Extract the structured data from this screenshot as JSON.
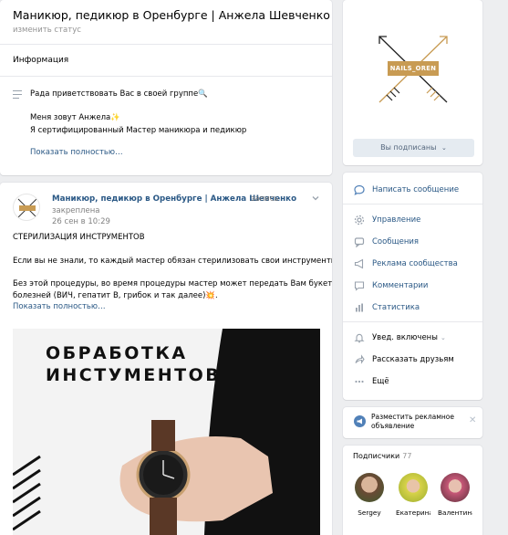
{
  "group": {
    "title": "Маникюр, педикюр в Оренбурге | Анжела Шевченко",
    "change_status": "изменить статус",
    "info_label": "Информация",
    "description_lines": [
      "Рада приветствовать Вас в своей группе🔍",
      "Меня зовут Анжела✨",
      "Я сертифицированный Мастер маникюра и педикюр"
    ],
    "show_more": "Показать полностью…"
  },
  "post": {
    "author": "Маникюр, педикюр в Оренбурге | Анжела Шевченко",
    "pinned_word": "запись",
    "pinned_word2": "закреплена",
    "date": "26 сен в 10:29",
    "lines": [
      "СТЕРИЛИЗАЦИЯ ИНСТРУМЕНТОВ",
      "Если вы не знали, то каждый мастер обязан стерилизовать свои инструменты🔝.",
      "Без этой процедуры, во время процедуры мастер может передать Вам букет",
      "болезней (ВИЧ, гепатит В, грибок и так далее)💥."
    ],
    "show_more": "Показать полностью…",
    "image_title_line1": "ОБРАБОТКА",
    "image_title_line2": "ИНСТУМЕНТОВ",
    "avatar_label": "NAILS_OREN"
  },
  "sidebar": {
    "logo_label": "NAILS_OREN",
    "subscribed_button": "Вы подписаны",
    "actions": [
      {
        "label": "Написать сообщение",
        "icon": "message-icon"
      },
      {
        "label": "Управление",
        "icon": "gear-icon"
      },
      {
        "label": "Сообщения",
        "icon": "chat-icon"
      },
      {
        "label": "Реклама сообщества",
        "icon": "megaphone-icon"
      },
      {
        "label": "Комментарии",
        "icon": "comment-icon"
      },
      {
        "label": "Статистика",
        "icon": "stats-icon"
      },
      {
        "label": "Увед. включены",
        "icon": "bell-icon"
      },
      {
        "label": "Рассказать друзьям",
        "icon": "share-icon"
      },
      {
        "label": "Ещё",
        "icon": "more-icon"
      }
    ],
    "ad_line1": "Разместить рекламное",
    "ad_line2": "объявление",
    "subscribers_title": "Подписчики",
    "subscribers_count": "77",
    "subscribers": [
      {
        "name": "Sergey",
        "color": "#8a6a52"
      },
      {
        "name": "Екатерина",
        "color": "#c9c23a"
      },
      {
        "name": "Валентина",
        "color": "#b84a6a"
      }
    ]
  },
  "colors": {
    "link": "#2a5885",
    "brand_gold": "#c89b53",
    "vk_blue": "#5181b8"
  }
}
